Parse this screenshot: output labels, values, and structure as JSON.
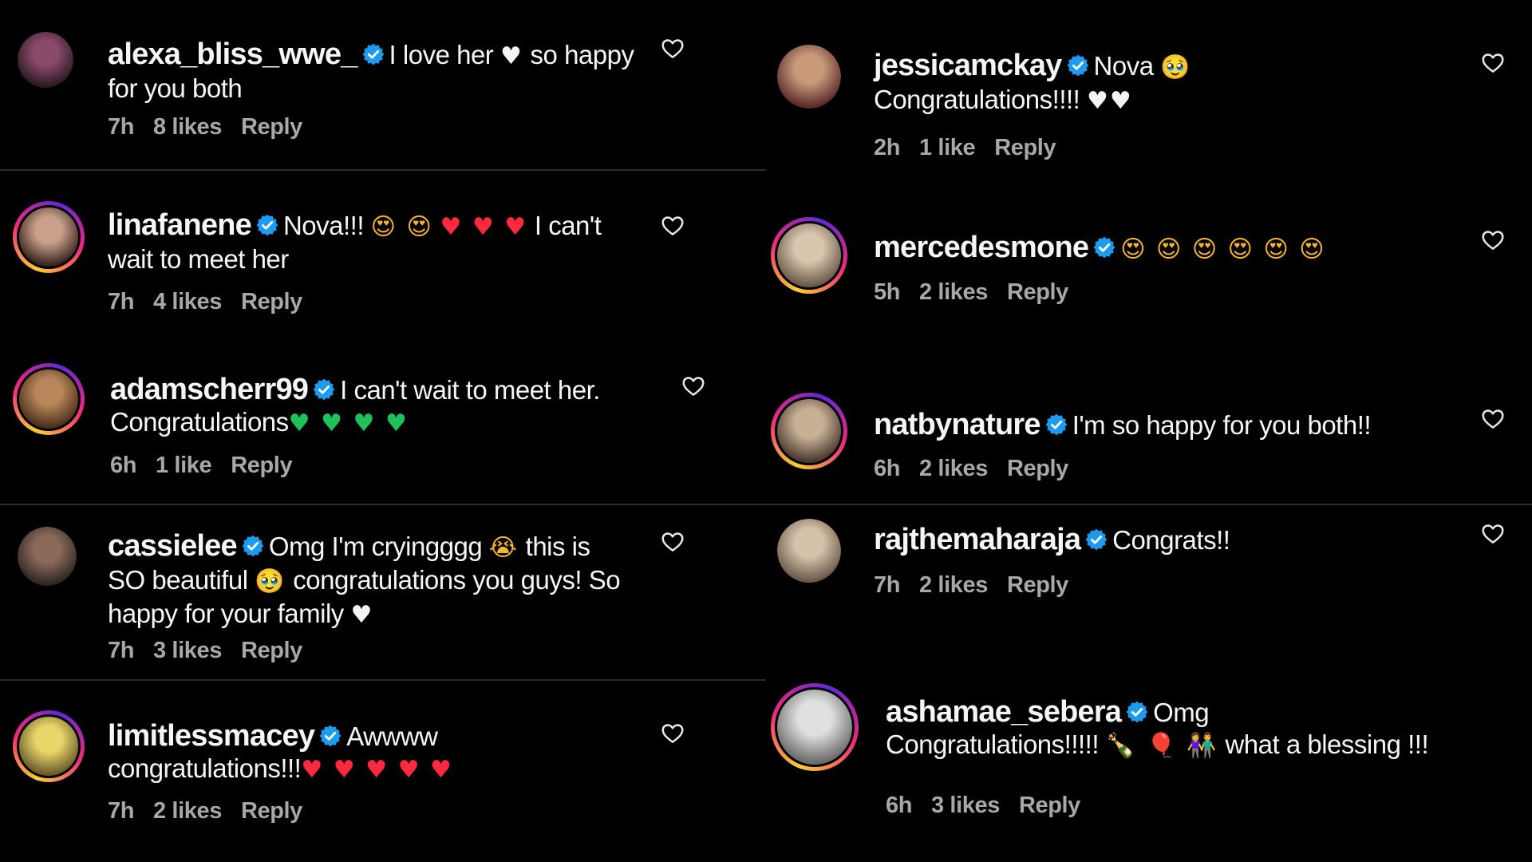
{
  "left_comments": [
    {
      "username": "alexa_bliss_wwe_",
      "lines": [
        [
          {
            "t": "I love her "
          },
          {
            "e": "♥",
            "c": "white"
          },
          {
            "t": " so happy"
          }
        ],
        [
          {
            "t": "for you both"
          }
        ]
      ],
      "time": "7h",
      "likes": "8 likes",
      "reply": "Reply"
    },
    {
      "username": "linafanene",
      "lines": [
        [
          {
            "t": "Nova!!! "
          },
          {
            "e": "😍 😍",
            "c": "yellow"
          },
          {
            "t": " "
          },
          {
            "e": "♥ ♥ ♥",
            "c": "red"
          },
          {
            "t": "  I can't"
          }
        ],
        [
          {
            "t": "wait to meet her"
          }
        ]
      ],
      "time": "7h",
      "likes": "4 likes",
      "reply": "Reply"
    },
    {
      "username": "adamscherr99",
      "lines": [
        [
          {
            "t": "I can't wait to meet her."
          }
        ],
        [
          {
            "t": "Congratulations"
          },
          {
            "e": "♥ ♥ ♥ ♥",
            "c": "green"
          }
        ]
      ],
      "time": "6h",
      "likes": "1 like",
      "reply": "Reply"
    },
    {
      "username": "cassielee",
      "lines": [
        [
          {
            "t": "Omg I'm cryingggg "
          },
          {
            "e": "😭",
            "c": "yellow"
          },
          {
            "t": " this is"
          }
        ],
        [
          {
            "t": "SO beautiful "
          },
          {
            "e": "🥹",
            "c": "yellow"
          },
          {
            "t": " congratulations you guys! So"
          }
        ],
        [
          {
            "t": "happy for your family "
          },
          {
            "e": "♥",
            "c": "white"
          }
        ]
      ],
      "time": "7h",
      "likes": "3 likes",
      "reply": "Reply"
    },
    {
      "username": "limitlessmacey",
      "lines": [
        [
          {
            "t": "Awwww"
          }
        ],
        [
          {
            "t": "congratulations!!!"
          },
          {
            "e": "♥ ♥ ♥ ♥ ♥",
            "c": "red"
          }
        ]
      ],
      "time": "7h",
      "likes": "2 likes",
      "reply": "Reply"
    }
  ],
  "right_comments": [
    {
      "username": "jessicamckay",
      "lines": [
        [
          {
            "t": "Nova "
          },
          {
            "e": "🥹",
            "c": "yellow"
          }
        ],
        [
          {
            "t": "Congratulations!!!! "
          },
          {
            "e": "♥♥",
            "c": "white"
          }
        ]
      ],
      "time": "2h",
      "likes": "1 like",
      "reply": "Reply"
    },
    {
      "username": "mercedesmone",
      "lines": [
        [
          {
            "e": "😍 😍 😍 😍 😍 😍",
            "c": "yellow"
          }
        ]
      ],
      "time": "5h",
      "likes": "2 likes",
      "reply": "Reply"
    },
    {
      "username": "natbynature",
      "lines": [
        [
          {
            "t": "I'm so happy for you both!!"
          }
        ]
      ],
      "time": "6h",
      "likes": "2 likes",
      "reply": "Reply"
    },
    {
      "username": "rajthemaharaja",
      "lines": [
        [
          {
            "t": "Congrats!!"
          }
        ]
      ],
      "time": "7h",
      "likes": "2 likes",
      "reply": "Reply"
    },
    {
      "username": "ashamae_sebera",
      "lines": [
        [
          {
            "t": "Omg"
          }
        ],
        [
          {
            "t": "Congratulations!!!!! "
          },
          {
            "e": "🍾 🎈 👫",
            "c": "yellow"
          },
          {
            "t": " what a blessing !!!"
          }
        ]
      ],
      "time": "6h",
      "likes": "3 likes",
      "reply": "Reply"
    }
  ],
  "colors": {
    "background": "#000000",
    "text": "#f5f5f5",
    "meta": "#a8a8a8",
    "verified": "#1d9bf0",
    "divider": "#2a2a2a"
  }
}
